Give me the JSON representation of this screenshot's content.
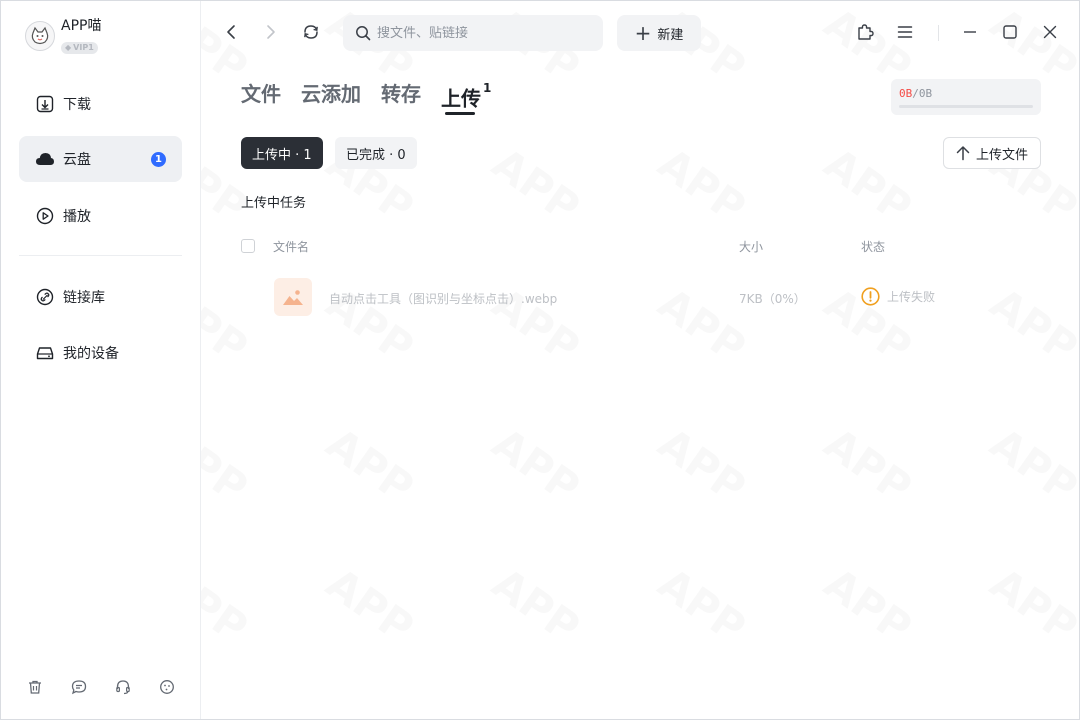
{
  "user": {
    "name": "APP喵",
    "vip_label": "VIP1"
  },
  "sidebar": {
    "items": [
      {
        "label": "下载",
        "icon": "download-box-icon"
      },
      {
        "label": "云盘",
        "icon": "cloud-icon",
        "badge": "1",
        "active": true
      },
      {
        "label": "播放",
        "icon": "play-circle-icon"
      },
      {
        "label": "链接库",
        "icon": "link-icon"
      },
      {
        "label": "我的设备",
        "icon": "device-drive-icon"
      }
    ],
    "bottom_icons": [
      "trash-icon",
      "chat-icon",
      "headset-icon",
      "cookie-icon"
    ]
  },
  "topbar": {
    "search_placeholder": "搜文件、贴链接",
    "new_button": "新建"
  },
  "tabs": [
    {
      "label": "文件"
    },
    {
      "label": "云添加"
    },
    {
      "label": "转存"
    },
    {
      "label": "上传",
      "count": "1",
      "active": true
    }
  ],
  "storage": {
    "used": "0B",
    "separator": "/",
    "total": "0B",
    "used_color": "#f54a45",
    "used_fraction": 0
  },
  "filters": {
    "uploading": "上传中 · 1",
    "completed": "已完成 · 0"
  },
  "upload_button": "上传文件",
  "section_title": "上传中任务",
  "table": {
    "headers": {
      "name": "文件名",
      "size": "大小",
      "status": "状态"
    },
    "rows": [
      {
        "name": "自动点击工具（图识别与坐标点击）.webp",
        "size": "7KB（0%）",
        "status": "上传失败",
        "status_color": "#f0a020"
      }
    ]
  },
  "colors": {
    "accent": "#2f6bff",
    "dark_pill": "#2b2f36",
    "warning": "#f0a020"
  }
}
